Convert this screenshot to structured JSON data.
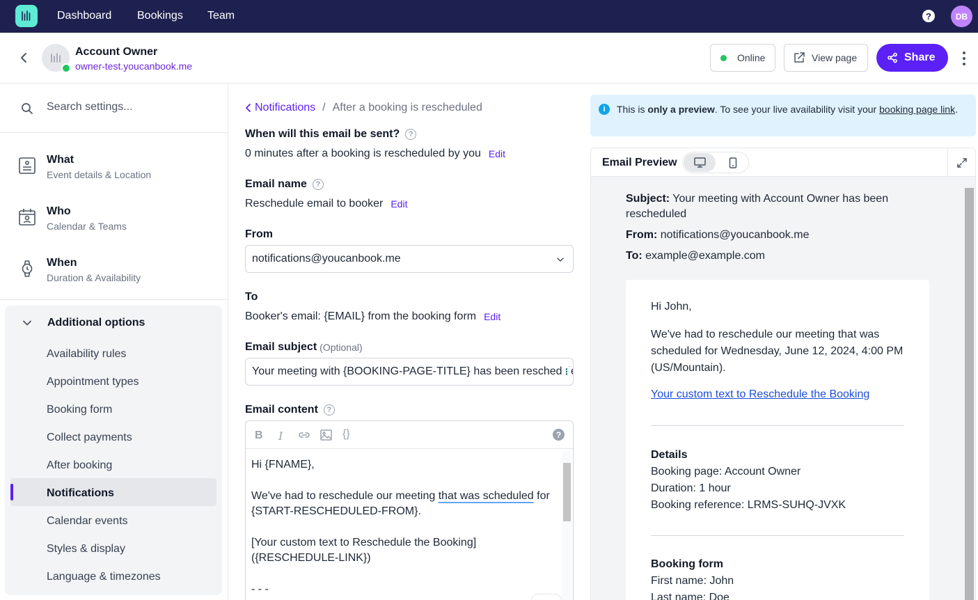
{
  "topnav": {
    "links": [
      "Dashboard",
      "Bookings",
      "Team"
    ],
    "avatar": "DB",
    "help": "?"
  },
  "header": {
    "name": "Account Owner",
    "url": "owner-test.youcanbook.me",
    "online_label": "Online",
    "view_label": "View page",
    "share_label": "Share"
  },
  "sidebar": {
    "search_placeholder": "Search settings...",
    "sections": [
      {
        "title": "What",
        "subtitle": "Event details & Location"
      },
      {
        "title": "Who",
        "subtitle": "Calendar & Teams"
      },
      {
        "title": "When",
        "subtitle": "Duration & Availability"
      }
    ],
    "additional": {
      "label": "Additional options",
      "items": [
        "Availability rules",
        "Appointment types",
        "Booking form",
        "Collect payments",
        "After booking",
        "Notifications",
        "Calendar events",
        "Styles & display",
        "Language & timezones"
      ],
      "active": "Notifications"
    }
  },
  "form": {
    "breadcrumb_link": "Notifications",
    "breadcrumb_sep": "/",
    "breadcrumb_current": "After a booking is rescheduled",
    "when_label": "When will this email be sent?",
    "when_value": "0 minutes after a booking is rescheduled by you",
    "edit_label": "Edit",
    "name_label": "Email name",
    "name_value": "Reschedule email to booker",
    "from_label": "From",
    "from_value": "notifications@youcanbook.me",
    "to_label": "To",
    "to_value": "Booker's email: {EMAIL} from the booking form",
    "subject_label": "Email subject",
    "subject_optional": "(Optional)",
    "subject_value": "Your meeting with {BOOKING-PAGE-TITLE} has been rescheduled",
    "content_label": "Email content",
    "content": {
      "line1": "Hi {FNAME},",
      "line2a": "We've had to reschedule our meeting ",
      "line2b": "that was scheduled",
      "line2c": " for {START-RESCHEDULED-FROM}.",
      "line3": "[Your custom text to Reschedule the Booking] ({RESCHEDULE-LINK})",
      "line4": "- - -"
    }
  },
  "preview": {
    "banner_pre": "This is ",
    "banner_bold": "only a preview",
    "banner_mid": ". To see your live availability visit your ",
    "banner_link": "booking page link",
    "banner_end": ".",
    "title": "Email Preview",
    "subject_label": "Subject:",
    "subject_value": "Your meeting with Account Owner has been rescheduled",
    "from_label": "From:",
    "from_value": "notifications@youcanbook.me",
    "to_label": "To:",
    "to_value": "example@example.com",
    "greeting": "Hi John,",
    "body": "We've had to reschedule our meeting that was scheduled for Wednesday, June 12, 2024, 4:00 PM (US/Mountain).",
    "link": "Your custom text to Reschedule the Booking",
    "details_heading": "Details",
    "details": [
      "Booking page: Account Owner",
      "Duration: 1 hour",
      "Booking reference: LRMS-SUHQ-JVXK"
    ],
    "form_heading": "Booking form",
    "form_fields": [
      "First name: John",
      "Last name: Doe"
    ]
  }
}
